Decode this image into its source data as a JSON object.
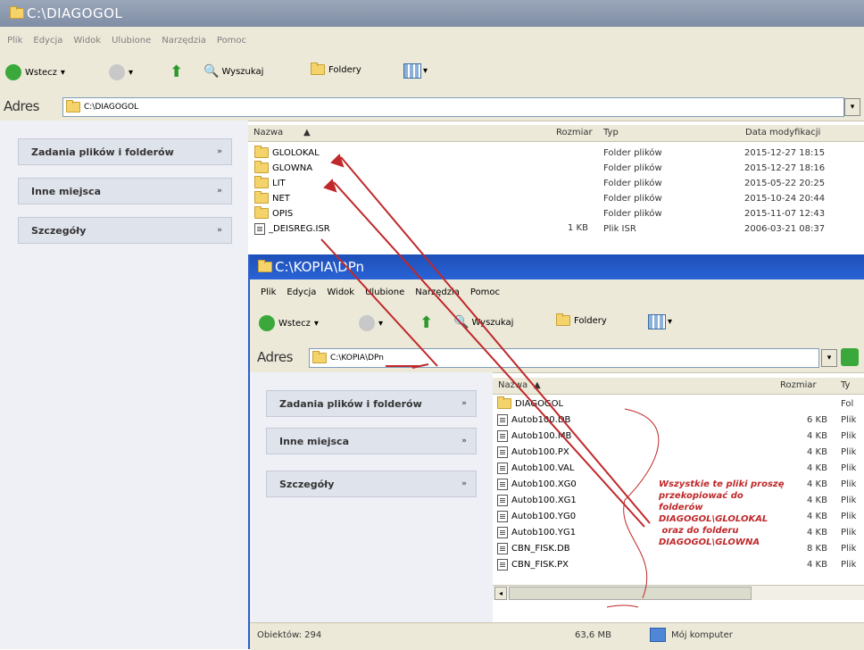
{
  "back_window": {
    "title": "C:\\DIAGOGOL",
    "menu": [
      "Plik",
      "Edycja",
      "Widok",
      "Ulubione",
      "Narzędzia",
      "Pomoc"
    ],
    "toolbar": {
      "back": "Wstecz",
      "search": "Wyszukaj",
      "folders": "Foldery"
    },
    "address": {
      "label": "Adres",
      "path": "C:\\DIAGOGOL"
    },
    "tasks": [
      "Zadania plików i folderów",
      "Inne miejsca",
      "Szczegóły"
    ],
    "columns": {
      "name": "Nazwa",
      "size": "Rozmiar",
      "type": "Typ",
      "modified": "Data modyfikacji"
    },
    "files": [
      {
        "name": "GLOLOKAL",
        "size": "",
        "type": "Folder plików",
        "modified": "2015-12-27 18:15",
        "icon": "folder-icon"
      },
      {
        "name": "GLOWNA",
        "size": "",
        "type": "Folder plików",
        "modified": "2015-12-27 18:16",
        "icon": "folder-icon"
      },
      {
        "name": "LIT",
        "size": "",
        "type": "Folder plików",
        "modified": "2015-05-22 20:25",
        "icon": "folder-icon"
      },
      {
        "name": "NET",
        "size": "",
        "type": "Folder plików",
        "modified": "2015-10-24 20:44",
        "icon": "folder-icon"
      },
      {
        "name": "OPIS",
        "size": "",
        "type": "Folder plików",
        "modified": "2015-11-07 12:43",
        "icon": "folder-icon"
      },
      {
        "name": "_DEISREG.ISR",
        "size": "1 KB",
        "type": "Plik ISR",
        "modified": "2006-03-21 08:37",
        "icon": "file-icon"
      }
    ]
  },
  "front_window": {
    "title": "C:\\KOPIA\\DPn",
    "menu": [
      "Plik",
      "Edycja",
      "Widok",
      "Ulubione",
      "Narzędzia",
      "Pomoc"
    ],
    "toolbar": {
      "back": "Wstecz",
      "search": "Wyszukaj",
      "folders": "Foldery"
    },
    "address": {
      "label": "Adres",
      "path": "C:\\KOPIA\\DPn"
    },
    "tasks": [
      "Zadania plików i folderów",
      "Inne miejsca",
      "Szczegóły"
    ],
    "columns": {
      "name": "Nazwa",
      "size": "Rozmiar",
      "type": "Ty"
    },
    "files": [
      {
        "name": "DIAGOGOL",
        "size": "",
        "type": "Fol",
        "icon": "folder-icon"
      },
      {
        "name": "Autob100.DB",
        "size": "6 KB",
        "type": "Plik",
        "icon": "file-icon"
      },
      {
        "name": "Autob100.MB",
        "size": "4 KB",
        "type": "Plik",
        "icon": "file-icon"
      },
      {
        "name": "Autob100.PX",
        "size": "4 KB",
        "type": "Plik",
        "icon": "file-icon"
      },
      {
        "name": "Autob100.VAL",
        "size": "4 KB",
        "type": "Plik",
        "icon": "file-icon"
      },
      {
        "name": "Autob100.XG0",
        "size": "4 KB",
        "type": "Plik",
        "icon": "file-icon"
      },
      {
        "name": "Autob100.XG1",
        "size": "4 KB",
        "type": "Plik",
        "icon": "file-icon"
      },
      {
        "name": "Autob100.YG0",
        "size": "4 KB",
        "type": "Plik",
        "icon": "file-icon"
      },
      {
        "name": "Autob100.YG1",
        "size": "4 KB",
        "type": "Plik",
        "icon": "file-icon"
      },
      {
        "name": "CBN_FISK.DB",
        "size": "8 KB",
        "type": "Plik",
        "icon": "file-icon"
      },
      {
        "name": "CBN_FISK.PX",
        "size": "4 KB",
        "type": "Plik",
        "icon": "file-icon"
      }
    ],
    "status": {
      "objects": "Obiektów: 294",
      "size": "63,6 MB",
      "location": "Mój komputer"
    }
  },
  "annotation": {
    "text": "Wszystkie te pliki proszę\nprzekopiować do\nfolderów\nDIAGOGOL\\GLOLOKAL\n oraz do folderu\nDIAGOGOL\\GLOWNA",
    "color": "#c0282a"
  }
}
